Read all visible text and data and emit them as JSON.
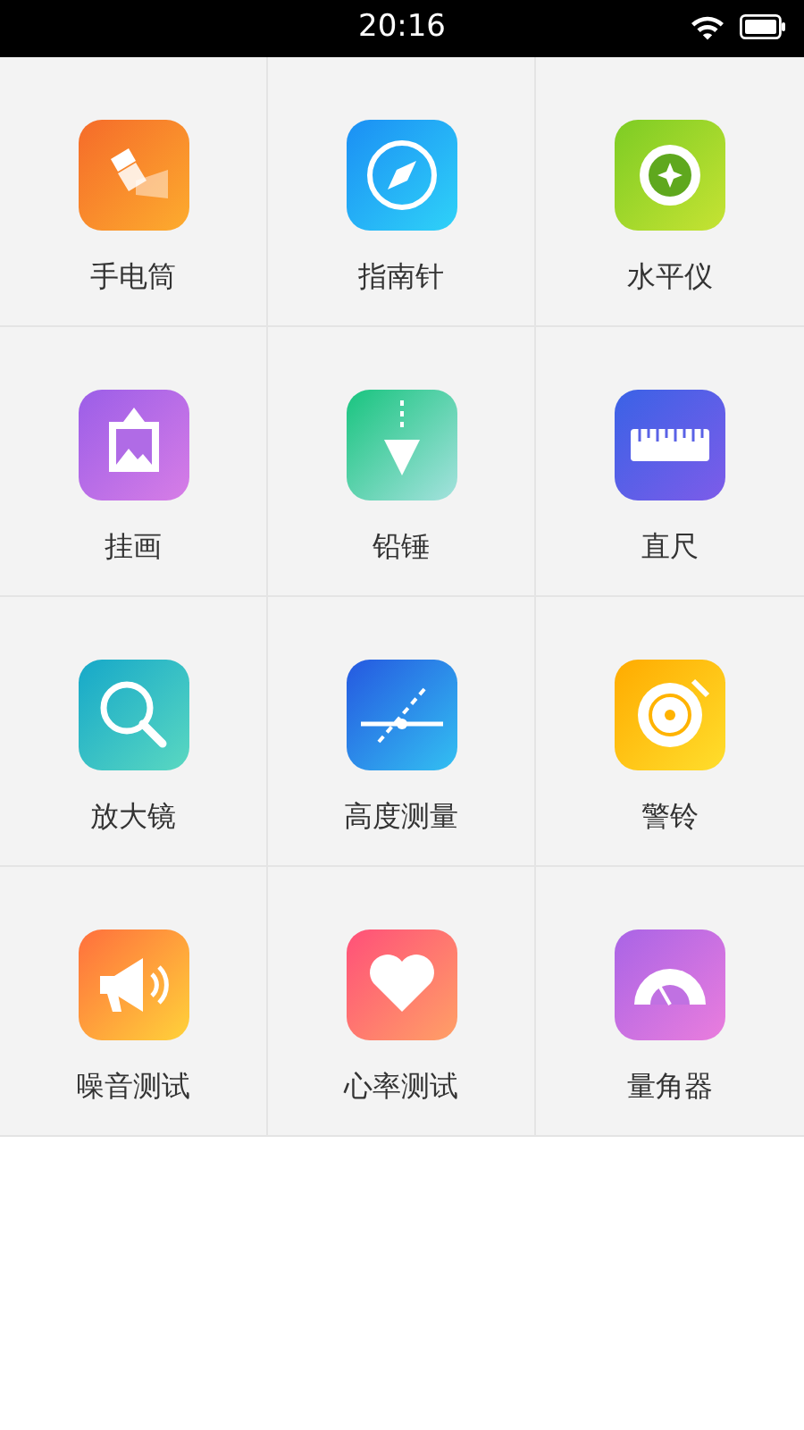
{
  "status_bar": {
    "time": "20:16"
  },
  "tools": [
    {
      "kind": "flashlight",
      "label": "手电筒"
    },
    {
      "kind": "compass",
      "label": "指南针"
    },
    {
      "kind": "level",
      "label": "水平仪"
    },
    {
      "kind": "picture",
      "label": "挂画"
    },
    {
      "kind": "plumb",
      "label": "铅锤"
    },
    {
      "kind": "ruler",
      "label": "直尺"
    },
    {
      "kind": "magnifier",
      "label": "放大镜"
    },
    {
      "kind": "height",
      "label": "高度测量"
    },
    {
      "kind": "alarm",
      "label": "警铃"
    },
    {
      "kind": "noise",
      "label": "噪音测试"
    },
    {
      "kind": "heart",
      "label": "心率测试"
    },
    {
      "kind": "protractor",
      "label": "量角器"
    }
  ]
}
